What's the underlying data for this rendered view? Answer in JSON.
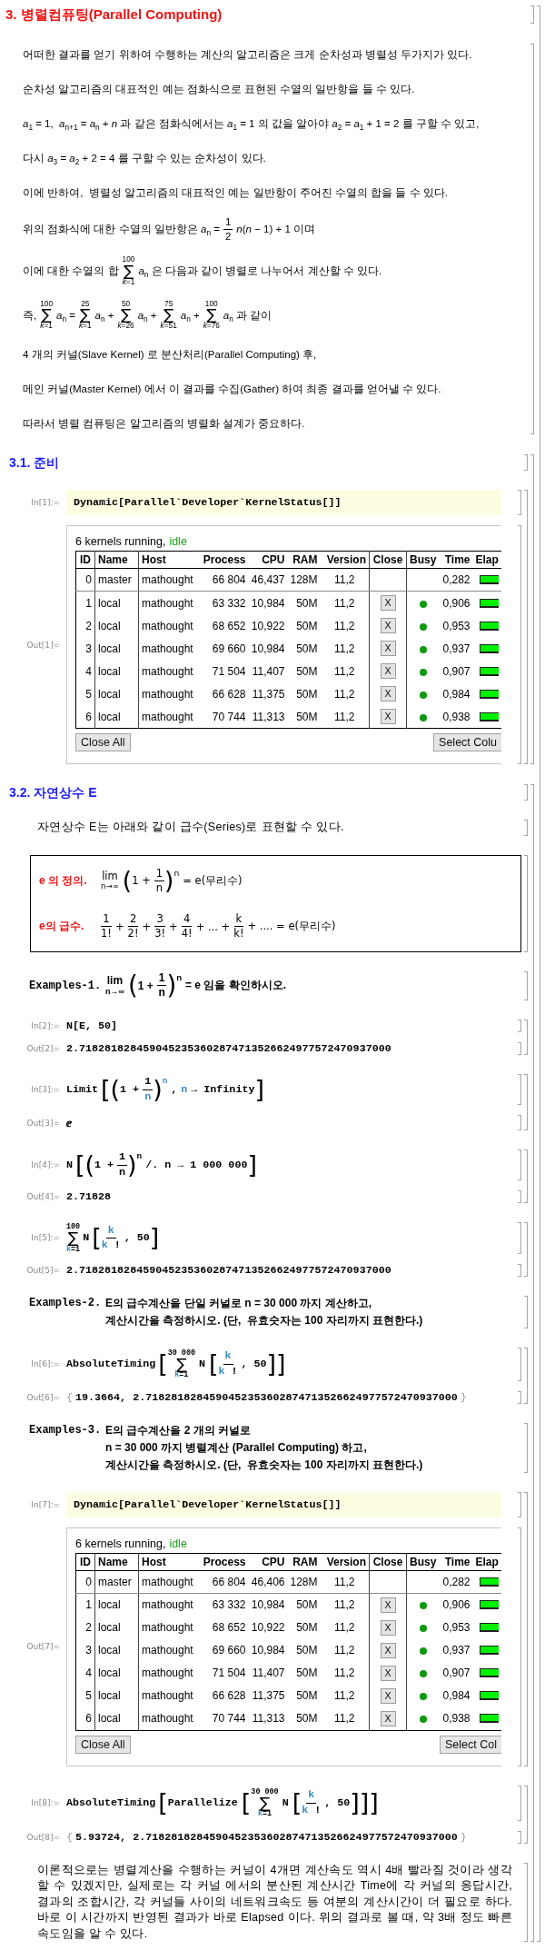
{
  "section": {
    "title": "3. 병렬컴퓨팅(Parallel Computing)",
    "lines": [
      [
        {
          "kind": "text",
          "text": "어떠한 결과를 얻기 위하여 수행하는 계산의 알고리즘은 크게 순차성과 병렬성 두가지가 있다."
        }
      ],
      [
        {
          "kind": "text",
          "text": "순차성 알고리즘의 대표적인 예는 점화식으로 표현된 수열의 일반항을 들 수 있다."
        }
      ],
      [
        {
          "kind": "text",
          "text": "*a*$_{1}$ = 1,  *a*$_{n+1}$ = *a*$_{n}$ + *n* 과 같은 점화식에서는 *a*$_{1}$ = 1 의 값을 알아야 *a*$_{2}$ = *a*$_{1}$ + 1 = 2 를 구할 수 있고,"
        }
      ],
      [
        {
          "kind": "text",
          "text": "다시 *a*$_{3}$ = *a*$_{2}$ + 2 = 4 를 구할 수 있는 순차성이 있다."
        }
      ],
      [
        {
          "kind": "text",
          "text": "이에 반하여,  병렬성 알고리즘의 대표적인 예는 일반항이 주어진 수열의 합을 들 수 있다."
        }
      ],
      [
        {
          "kind": "text",
          "text": "위의 점화식에 대한 수열의 일반항은 *a*$_{n}$ ="
        },
        {
          "kind": "frac",
          "num": "1",
          "den": "2"
        },
        {
          "kind": "text",
          "text": "*n*(*n* − 1) + 1 이며"
        }
      ],
      [
        {
          "kind": "text",
          "text": "이에 대한 수열의 합"
        },
        {
          "kind": "sum",
          "symbol": "∑",
          "upper": "100",
          "lower": "*k*=1"
        },
        {
          "kind": "text",
          "text": "*a*$_{n}$ 은 다음과 같이 병렬로 나누어서 계산할 수 있다."
        }
      ],
      [
        {
          "kind": "text",
          "text": "즉,"
        },
        {
          "kind": "sum",
          "symbol": "∑",
          "upper": "100",
          "lower": "*k*=1"
        },
        {
          "kind": "text",
          "text": "*a*$_{n}$ ="
        },
        {
          "kind": "sum",
          "symbol": "∑",
          "upper": "25",
          "lower": "*k*=1"
        },
        {
          "kind": "text",
          "text": "*a*$_{n}$ +"
        },
        {
          "kind": "sum",
          "symbol": "∑",
          "upper": "50",
          "lower": "*k*=26"
        },
        {
          "kind": "text",
          "text": "*a*$_{n}$ +"
        },
        {
          "kind": "sum",
          "symbol": "∑",
          "upper": "75",
          "lower": "*k*=51"
        },
        {
          "kind": "text",
          "text": "*a*$_{n}$ +"
        },
        {
          "kind": "sum",
          "symbol": "∑",
          "upper": "100",
          "lower": "*k*=76"
        },
        {
          "kind": "text",
          "text": "*a*$_{n}$ 과 같이"
        }
      ],
      [
        {
          "kind": "text",
          "text": "4 개의 커널(Slave Kernel) 로 분산처리(Parallel Computing) 후,"
        }
      ],
      [
        {
          "kind": "text",
          "text": "메인 커널(Master Kernel) 에서 이 결과를 수집(Gather) 하여 최종 결과를 얻어낼 수 있다."
        }
      ],
      [
        {
          "kind": "text",
          "text": "따라서 병렬 컴퓨팅은 알고리즘의 병렬화 설계가 중요하다."
        }
      ]
    ]
  },
  "subsections": [
    {
      "title": "3.1. 준비",
      "cells": [
        {
          "kind": "io",
          "input": {
            "label": "In[1]:=",
            "highlighted": true,
            "code": [
              {
                "kind": "text",
                "text": "Dynamic[Parallel`Developer`KernelStatus[]]"
              }
            ]
          },
          "output": {
            "label": "Out[1]=",
            "kind": "kernel_status",
            "summary": "6 kernels running,",
            "status": "idle",
            "columns": [
              "ID",
              "Name",
              "Host",
              "Process",
              "CPU",
              "RAM",
              "Version",
              "Close",
              "Busy",
              "Time",
              "Elap"
            ],
            "rows": [
              {
                "id": "0",
                "name": "master",
                "host": "mathought",
                "process": "66 804",
                "cpu": "46,437",
                "ram": "128M",
                "version": "11,2",
                "busy": false,
                "time": "0,282"
              },
              {
                "id": "1",
                "name": "local",
                "host": "mathought",
                "process": "63 332",
                "cpu": "10,984",
                "ram": "50M",
                "version": "11,2",
                "close": "X",
                "busy": true,
                "time": "0,906"
              },
              {
                "id": "2",
                "name": "local",
                "host": "mathought",
                "process": "68 652",
                "cpu": "10,922",
                "ram": "50M",
                "version": "11,2",
                "close": "X",
                "busy": true,
                "time": "0,953"
              },
              {
                "id": "3",
                "name": "local",
                "host": "mathought",
                "process": "69 660",
                "cpu": "10,984",
                "ram": "50M",
                "version": "11,2",
                "close": "X",
                "busy": true,
                "time": "0,937"
              },
              {
                "id": "4",
                "name": "local",
                "host": "mathought",
                "process": "71 504",
                "cpu": "11,407",
                "ram": "50M",
                "version": "11,2",
                "close": "X",
                "busy": true,
                "time": "0,907"
              },
              {
                "id": "5",
                "name": "local",
                "host": "mathought",
                "process": "66 628",
                "cpu": "11,375",
                "ram": "50M",
                "version": "11,2",
                "close": "X",
                "busy": true,
                "time": "0,984"
              },
              {
                "id": "6",
                "name": "local",
                "host": "mathought",
                "process": "70 744",
                "cpu": "11,313",
                "ram": "50M",
                "version": "11,2",
                "close": "X",
                "busy": true,
                "time": "0,938"
              }
            ],
            "buttons": [
              "Close All",
              "Select Colu"
            ]
          }
        }
      ]
    },
    {
      "title": "3.2. 자연상수 E",
      "cells": [
        {
          "kind": "text",
          "lines": [
            [
              {
                "kind": "text",
                "text": "자연상수 E는 아래와 같이 급수(Series)로 표현할 수 있다."
              }
            ]
          ]
        },
        {
          "kind": "box",
          "rows": [
            {
              "label": "e 의 정의.",
              "math": [
                {
                  "kind": "lim",
                  "text": "lim",
                  "under": "n→∞"
                },
                {
                  "kind": "fence",
                  "open": "(",
                  "close": ")",
                  "body": [
                    {
                      "kind": "text",
                      "text": "1 +"
                    },
                    {
                      "kind": "frac",
                      "num": "1",
                      "den": "n"
                    }
                  ],
                  "sup": "n"
                },
                {
                  "kind": "text",
                  "text": "= e(무리수)"
                }
              ]
            },
            {
              "label": "e의 급수.",
              "math": [
                {
                  "kind": "frac",
                  "num": "1",
                  "den": "1!"
                },
                {
                  "kind": "text",
                  "text": "+"
                },
                {
                  "kind": "frac",
                  "num": "2",
                  "den": "2!"
                },
                {
                  "kind": "text",
                  "text": "+"
                },
                {
                  "kind": "frac",
                  "num": "3",
                  "den": "3!"
                },
                {
                  "kind": "text",
                  "text": "+"
                },
                {
                  "kind": "frac",
                  "num": "4",
                  "den": "4!"
                },
                {
                  "kind": "text",
                  "text": "+ ... +"
                },
                {
                  "kind": "frac",
                  "num": "k",
                  "den": "k!"
                },
                {
                  "kind": "text",
                  "text": "+ .... = e(무리수)"
                }
              ]
            }
          ]
        },
        {
          "kind": "example",
          "label": "Examples-1.",
          "lines": [
            [
              {
                "kind": "lim",
                "text": "lim",
                "under": "n→∞"
              },
              {
                "kind": "fence",
                "open": "(",
                "close": ")",
                "body": [
                  {
                    "kind": "text",
                    "text": "1 +"
                  },
                  {
                    "kind": "frac",
                    "num": "1",
                    "den": "n"
                  }
                ],
                "sup": "n"
              },
              {
                "kind": "text",
                "text": "= e 임을 확인하시오."
              }
            ]
          ]
        },
        {
          "kind": "io",
          "input": {
            "label": "In[2]:=",
            "highlighted": false,
            "code": [
              {
                "kind": "text",
                "text": "N[E, 50]"
              }
            ]
          },
          "output": {
            "label": "Out[2]=",
            "kind": "math",
            "math": [
              {
                "kind": "text",
                "text": "2.7182818284590452353602874713526624977572470937000"
              }
            ]
          }
        },
        {
          "kind": "io",
          "input": {
            "label": "In[3]:=",
            "highlighted": false,
            "code": [
              {
                "kind": "text",
                "text": "Limit"
              },
              {
                "kind": "fence",
                "open": "[",
                "close": "]",
                "body": [
                  {
                    "kind": "fence",
                    "open": "(",
                    "close": ")",
                    "body": [
                      {
                        "kind": "text",
                        "text": "1 +"
                      },
                      {
                        "kind": "frac",
                        "num": "1",
                        "den": [
                          {
                            "kind": "var",
                            "text": "n"
                          }
                        ]
                      }
                    ],
                    "sup": [
                      {
                        "kind": "var",
                        "text": "n"
                      }
                    ]
                  },
                  {
                    "kind": "text",
                    "text": ","
                  },
                  {
                    "kind": "var",
                    "text": "n"
                  },
                  {
                    "kind": "text",
                    "text": "→ Infinity"
                  }
                ]
              }
            ]
          },
          "output": {
            "label": "Out[3]=",
            "kind": "math",
            "math": [
              {
                "kind": "text",
                "text": "ⅇ"
              }
            ]
          }
        },
        {
          "kind": "io",
          "input": {
            "label": "In[4]:=",
            "highlighted": false,
            "code": [
              {
                "kind": "text",
                "text": "N"
              },
              {
                "kind": "fence",
                "open": "[",
                "close": "]",
                "body": [
                  {
                    "kind": "fence",
                    "open": "(",
                    "close": ")",
                    "body": [
                      {
                        "kind": "text",
                        "text": "1 +"
                      },
                      {
                        "kind": "frac",
                        "num": "1",
                        "den": "n"
                      }
                    ],
                    "sup": "n"
                  },
                  {
                    "kind": "text",
                    "text": "/. n → 1 000 000"
                  }
                ]
              }
            ]
          },
          "output": {
            "label": "Out[4]=",
            "kind": "math",
            "math": [
              {
                "kind": "text",
                "text": "2.71828"
              }
            ]
          }
        },
        {
          "kind": "io",
          "input": {
            "label": "In[5]:=",
            "highlighted": false,
            "code": [
              {
                "kind": "sum",
                "symbol": "∑",
                "upper": "100",
                "lower": [
                  {
                    "kind": "var",
                    "text": "k"
                  },
                  {
                    "kind": "text",
                    "text": "=1"
                  }
                ]
              },
              {
                "kind": "text",
                "text": "N"
              },
              {
                "kind": "fence",
                "open": "[",
                "close": "]",
                "body": [
                  {
                    "kind": "frac",
                    "num": [
                      {
                        "kind": "var",
                        "text": "k"
                      }
                    ],
                    "den": [
                      {
                        "kind": "var",
                        "text": "k"
                      },
                      {
                        "kind": "text",
                        "text": " !"
                      }
                    ]
                  },
                  {
                    "kind": "text",
                    "text": ", 50"
                  }
                ]
              }
            ]
          },
          "output": {
            "label": "Out[5]=",
            "kind": "math",
            "math": [
              {
                "kind": "text",
                "text": "2.7182818284590452353602874713526624977572470937000"
              }
            ]
          }
        },
        {
          "kind": "example",
          "label": "Examples-2.",
          "lines": [
            [
              {
                "kind": "text",
                "text": "E의 급수계산을 단일 커널로 n = 30 000 까지 계산하고,"
              }
            ],
            [
              {
                "kind": "text",
                "text": "계산시간을 측정하시오. (단,  유효숫자는 100 자리까지 표현한다.)"
              }
            ]
          ]
        },
        {
          "kind": "io",
          "input": {
            "label": "In[6]:=",
            "highlighted": false,
            "code": [
              {
                "kind": "text",
                "text": "AbsoluteTiming"
              },
              {
                "kind": "fence",
                "open": "[",
                "close": "]",
                "body": [
                  {
                    "kind": "sum",
                    "symbol": "∑",
                    "upper": "30 000",
                    "lower": [
                      {
                        "kind": "var",
                        "text": "k"
                      },
                      {
                        "kind": "text",
                        "text": "=1"
                      }
                    ]
                  },
                  {
                    "kind": "text",
                    "text": "N"
                  },
                  {
                    "kind": "fence",
                    "open": "[",
                    "close": "]",
                    "body": [
                      {
                        "kind": "frac",
                        "num": [
                          {
                            "kind": "var",
                            "text": "k"
                          }
                        ],
                        "den": [
                          {
                            "kind": "var",
                            "text": "k"
                          },
                          {
                            "kind": "text",
                            "text": " !"
                          }
                        ]
                      },
                      {
                        "kind": "text",
                        "text": ", 50"
                      }
                    ]
                  }
                ]
              }
            ]
          },
          "output": {
            "label": "Out[6]=",
            "kind": "math",
            "math": [
              {
                "kind": "punct",
                "text": "{"
              },
              {
                "kind": "text",
                "text": "19.3664, 2.7182818284590452353602874713526624977572470937000"
              },
              {
                "kind": "punct",
                "text": "}"
              }
            ]
          }
        },
        {
          "kind": "example",
          "label": "Examples-3.",
          "lines": [
            [
              {
                "kind": "text",
                "text": "E의 급수계산을 2 개의 커널로"
              }
            ],
            [
              {
                "kind": "text",
                "text": "n = 30 000 까지 병렬계산 (Parallel Computing) 하고,"
              }
            ],
            [
              {
                "kind": "text",
                "text": "계산시간을 측정하시오. (단,  유효숫자는 100 자리까지 표현한다.)"
              }
            ]
          ]
        },
        {
          "kind": "io",
          "input": {
            "label": "In[7]:=",
            "highlighted": true,
            "code": [
              {
                "kind": "text",
                "text": "Dynamic[Parallel`Developer`KernelStatus[]]"
              }
            ]
          },
          "output": {
            "label": "Out[7]=",
            "kind": "kernel_status",
            "summary": "6 kernels running,",
            "status": "idle",
            "columns": [
              "ID",
              "Name",
              "Host",
              "Process",
              "CPU",
              "RAM",
              "Version",
              "Close",
              "Busy",
              "Time",
              "Elap"
            ],
            "rows": [
              {
                "id": "0",
                "name": "master",
                "host": "mathought",
                "process": "66 804",
                "cpu": "46,406",
                "ram": "128M",
                "version": "11,2",
                "busy": false,
                "time": "0,282"
              },
              {
                "id": "1",
                "name": "local",
                "host": "mathought",
                "process": "63 332",
                "cpu": "10,984",
                "ram": "50M",
                "version": "11,2",
                "close": "X",
                "busy": true,
                "time": "0,906"
              },
              {
                "id": "2",
                "name": "local",
                "host": "mathought",
                "process": "68 652",
                "cpu": "10,922",
                "ram": "50M",
                "version": "11,2",
                "close": "X",
                "busy": true,
                "time": "0,953"
              },
              {
                "id": "3",
                "name": "local",
                "host": "mathought",
                "process": "69 660",
                "cpu": "10,984",
                "ram": "50M",
                "version": "11,2",
                "close": "X",
                "busy": true,
                "time": "0,937"
              },
              {
                "id": "4",
                "name": "local",
                "host": "mathought",
                "process": "71 504",
                "cpu": "11,407",
                "ram": "50M",
                "version": "11,2",
                "close": "X",
                "busy": true,
                "time": "0,907"
              },
              {
                "id": "5",
                "name": "local",
                "host": "mathought",
                "process": "66 628",
                "cpu": "11,375",
                "ram": "50M",
                "version": "11,2",
                "close": "X",
                "busy": true,
                "time": "0,984"
              },
              {
                "id": "6",
                "name": "local",
                "host": "mathought",
                "process": "70 744",
                "cpu": "11,313",
                "ram": "50M",
                "version": "11,2",
                "close": "X",
                "busy": true,
                "time": "0,938"
              }
            ],
            "buttons": [
              "Close All",
              "Select Col"
            ]
          }
        },
        {
          "kind": "io",
          "input": {
            "label": "In[8]:=",
            "highlighted": false,
            "code": [
              {
                "kind": "text",
                "text": "AbsoluteTiming"
              },
              {
                "kind": "fence",
                "open": "[",
                "close": "]",
                "body": [
                  {
                    "kind": "text",
                    "text": "Parallelize"
                  },
                  {
                    "kind": "fence",
                    "open": "[",
                    "close": "]",
                    "body": [
                      {
                        "kind": "sum",
                        "symbol": "∑",
                        "upper": "30 000",
                        "lower": [
                          {
                            "kind": "var",
                            "text": "k"
                          },
                          {
                            "kind": "text",
                            "text": "=1"
                          }
                        ]
                      },
                      {
                        "kind": "text",
                        "text": "N"
                      },
                      {
                        "kind": "fence",
                        "open": "[",
                        "close": "]",
                        "body": [
                          {
                            "kind": "frac",
                            "num": [
                              {
                                "kind": "var",
                                "text": "k"
                              }
                            ],
                            "den": [
                              {
                                "kind": "var",
                                "text": "k"
                              },
                              {
                                "kind": "text",
                                "text": " !"
                              }
                            ]
                          },
                          {
                            "kind": "text",
                            "text": ", 50"
                          }
                        ]
                      }
                    ]
                  }
                ]
              }
            ]
          },
          "output": {
            "label": "Out[8]=",
            "kind": "math",
            "math": [
              {
                "kind": "punct",
                "text": "{"
              },
              {
                "kind": "text",
                "text": "5.93724, 2.7182818284590452353602874713526624977572470937000"
              },
              {
                "kind": "punct",
                "text": "}"
              }
            ]
          }
        },
        {
          "kind": "text",
          "lines": [
            [
              {
                "kind": "text",
                "text": "이론적으로는 병렬계산을 수행하는 커널이 4개면 계산속도 역시 4배 빨라질 것이라 생각할 수 있겠지만, 실제로는 각 커널 에서의 분산된 계산시간 Time에 각 커널의 응답시간, 결과의 조합시간, 각 커널들 사이의 네트워크속도 등 여분의 계산시간이 더 필요로 하다. 바로 이 시간까지 반영된 결과가 바로 Elapsed 이다. 위의 결과로 볼 때, 약 3배 정도 빠른 속도임을 알 수 있다."
              }
            ]
          ]
        }
      ]
    }
  ]
}
